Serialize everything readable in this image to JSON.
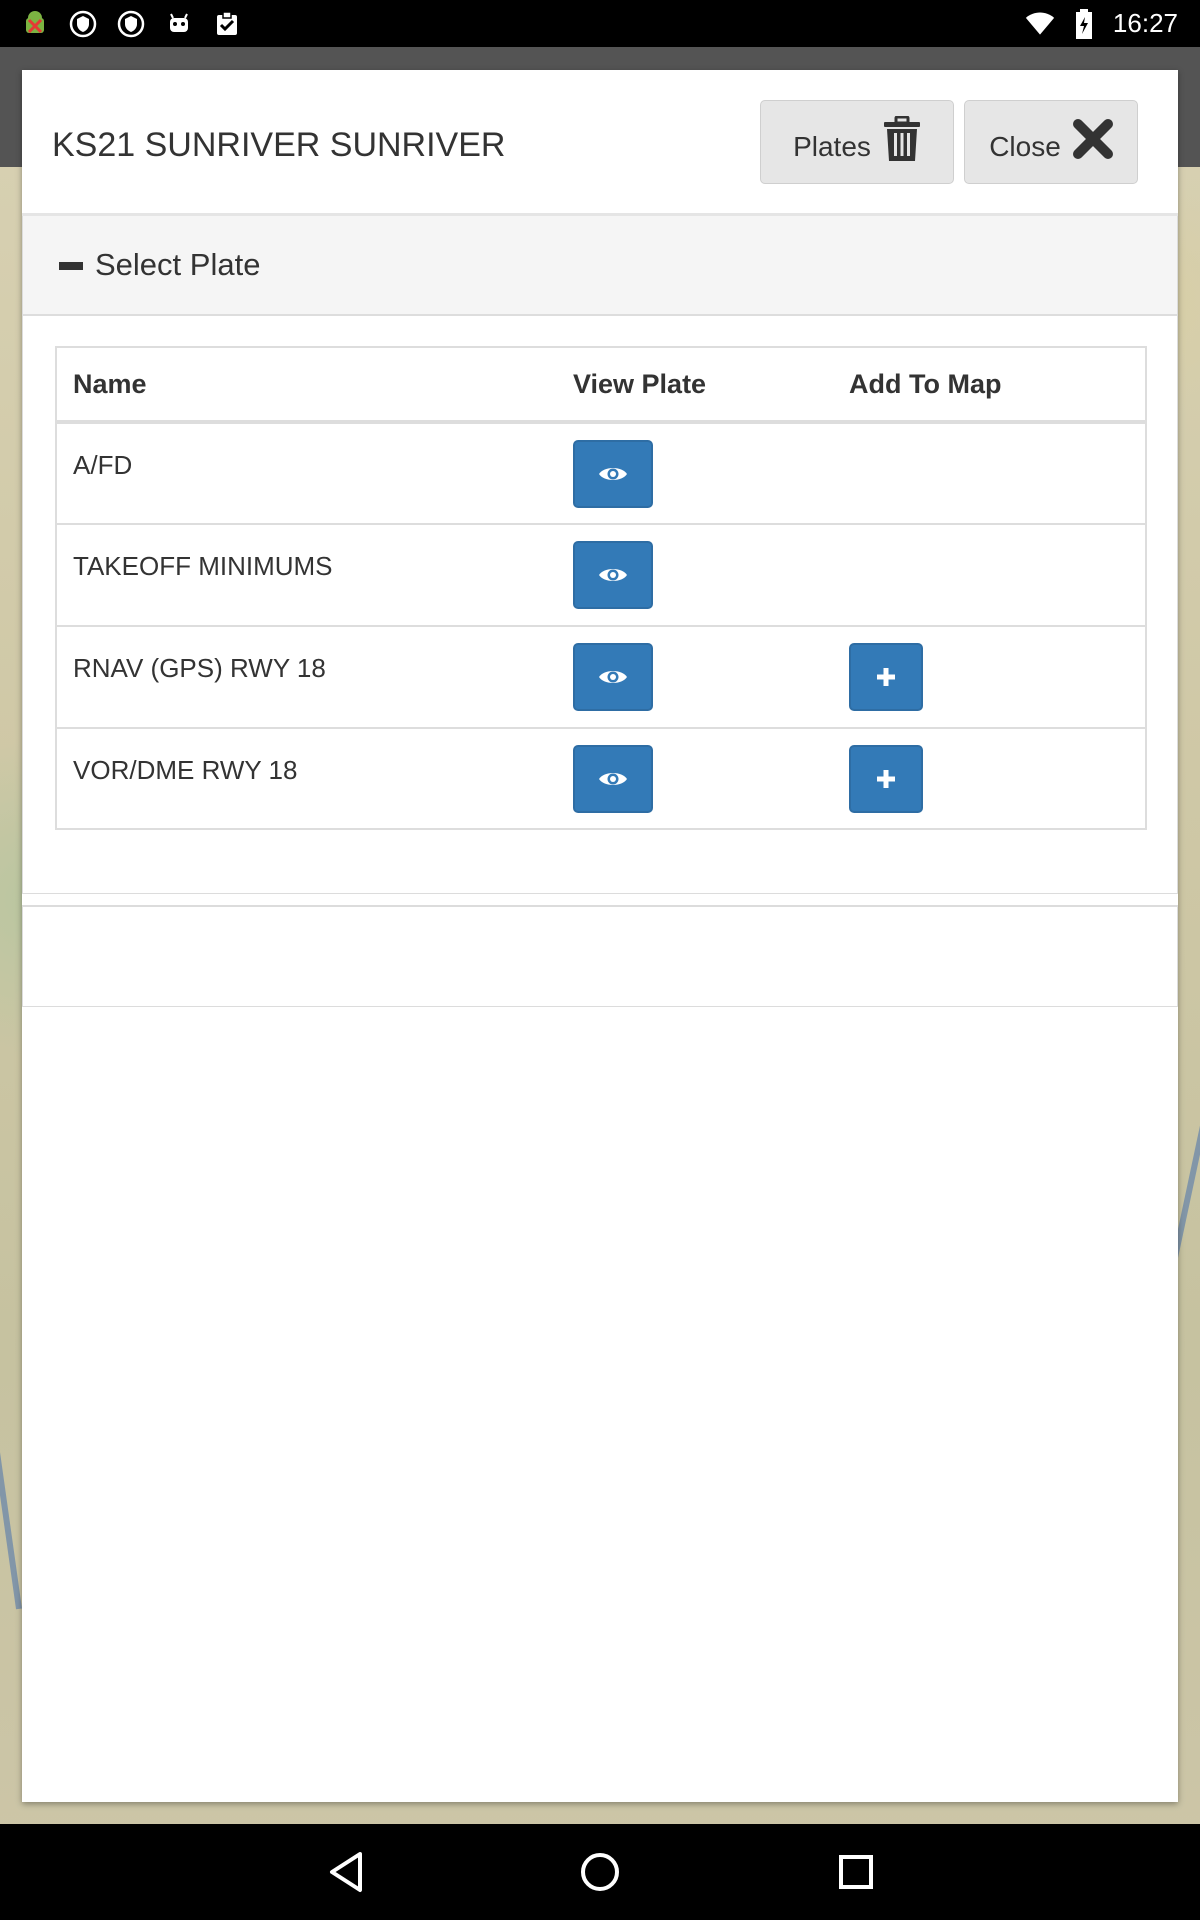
{
  "status_bar": {
    "time": "16:27",
    "left_icons": [
      "android-debug-icon",
      "shield-icon",
      "shield-icon",
      "android-icon",
      "clipboard-check-icon"
    ],
    "right_icons": [
      "wifi-icon",
      "battery-icon"
    ]
  },
  "modal": {
    "title": "KS21 SUNRIVER SUNRIVER",
    "plates_button": "Plates",
    "close_button": "Close"
  },
  "panel": {
    "heading": "Select Plate",
    "columns": [
      "Name",
      "View Plate",
      "Add To Map"
    ],
    "rows": [
      {
        "name": "A/FD",
        "view": true,
        "add": false
      },
      {
        "name": "TAKEOFF MINIMUMS",
        "view": true,
        "add": false
      },
      {
        "name": "RNAV (GPS) RWY 18",
        "view": true,
        "add": true
      },
      {
        "name": "VOR/DME RWY 18",
        "view": true,
        "add": true
      }
    ]
  },
  "colors": {
    "primary_button": "#337ab7",
    "default_button": "#e6e6e6",
    "status_bar": "#000000"
  }
}
